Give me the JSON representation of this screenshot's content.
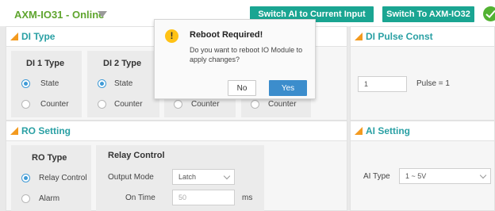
{
  "header": {
    "module_title": "AXM-IO31 - Online",
    "switch_ai_label": "Switch AI to Current Input",
    "switch_io_label": "Switch To AXM-IO32"
  },
  "di_type": {
    "title": "DI Type",
    "channels": [
      {
        "title": "DI 1 Type",
        "options": [
          "State",
          "Counter"
        ],
        "selected": "State"
      },
      {
        "title": "DI 2 Type",
        "options": [
          "State",
          "Counter"
        ],
        "selected": "State"
      },
      {
        "title": "",
        "options": [
          "Counter"
        ],
        "selected": ""
      },
      {
        "title": "",
        "options": [
          "Counter"
        ],
        "selected": ""
      }
    ]
  },
  "di_pulse_const": {
    "title": "DI Pulse Const",
    "value": "1",
    "pulse_label": "Pulse = 1"
  },
  "ro_setting": {
    "title": "RO Setting",
    "ro_type_title": "RO Type",
    "ro_options": [
      "Relay Control",
      "Alarm"
    ],
    "ro_selected": "Relay Control",
    "relay_control_title": "Relay Control",
    "output_mode_label": "Output Mode",
    "output_mode_value": "Latch",
    "on_time_label": "On Time",
    "on_time_value": "50",
    "on_time_unit": "ms"
  },
  "ai_setting": {
    "title": "AI Setting",
    "ai_type_label": "AI Type",
    "ai_type_value": "1 ~ 5V"
  },
  "dialog": {
    "title": "Reboot Required!",
    "message": "Do you want to reboot IO Module to apply changes?",
    "no_label": "No",
    "yes_label": "Yes",
    "warning_glyph": "!"
  },
  "colors": {
    "online_green": "#5fa52e",
    "teal_button": "#1aa592",
    "section_title": "#2aa0a4",
    "accent_orange": "#f39a1f",
    "primary_blue": "#3c8dcc",
    "warning_yellow": "#ffc215"
  },
  "icons": {
    "dropdown": "caret-down-icon",
    "status": "check-circle-icon",
    "section": "triangle-corner-icon",
    "dialog": "warning-icon"
  }
}
